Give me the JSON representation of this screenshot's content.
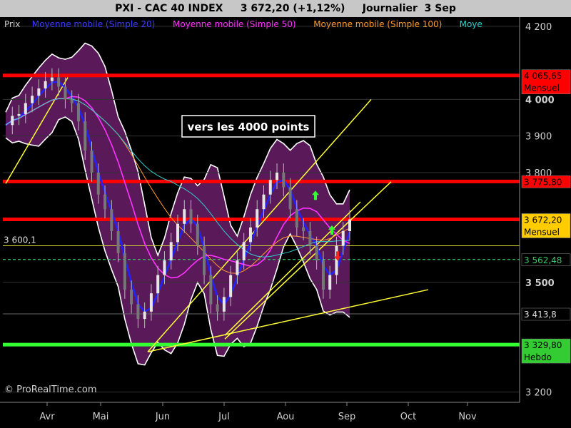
{
  "header": {
    "title": "PXI - CAC 40 INDEX     3 672,20 (+1,12%)     Journalier  3 Sep"
  },
  "chart_data": {
    "type": "candlestick",
    "legend": [
      {
        "label": "Prix",
        "color": "#cfcfcf"
      },
      {
        "label": "Moyenne mobile (Simple 20)",
        "color": "#3b3bff"
      },
      {
        "label": "Moyenne mobile (Simple 50)",
        "color": "#ff33ff"
      },
      {
        "label": "Moyenne mobile (Simple 100)",
        "color": "#ff9a2e"
      },
      {
        "label": "Moye",
        "color": "#33cccc"
      }
    ],
    "x_ticks": [
      "Avr",
      "Mai",
      "Jun",
      "Jul",
      "Aou",
      "Sep",
      "Oct",
      "Nov"
    ],
    "y_ticks": [
      {
        "value": 4200,
        "label": "4 200",
        "bold": false
      },
      {
        "value": 4000,
        "label": "4 000",
        "bold": true
      },
      {
        "value": 3900,
        "label": "3 900",
        "bold": false
      },
      {
        "value": 3800,
        "label": "3 800",
        "bold": false
      },
      {
        "value": 3500,
        "label": "3 500",
        "bold": true
      },
      {
        "value": 3200,
        "label": "3 200",
        "bold": false
      }
    ],
    "ylim": [
      3172,
      4225
    ],
    "close_series": [
      3930,
      3955,
      3960,
      3990,
      4010,
      4030,
      4050,
      4060,
      4035,
      4000,
      3990,
      3940,
      3860,
      3800,
      3740,
      3700,
      3640,
      3580,
      3480,
      3440,
      3400,
      3420,
      3470,
      3520,
      3560,
      3610,
      3660,
      3700,
      3660,
      3600,
      3520,
      3440,
      3420,
      3460,
      3520,
      3560,
      3610,
      3650,
      3700,
      3740,
      3780,
      3800,
      3760,
      3700,
      3650,
      3640,
      3600,
      3560,
      3480,
      3520,
      3600,
      3640,
      3672
    ],
    "annotation": "vers les 4000 points",
    "level_labels": [
      {
        "value": 4065.65,
        "label": "4 065,65",
        "sub": "Mensuel",
        "bg": "#ff0000",
        "fg": "#000000",
        "line": "#ff0000",
        "line_style": "thick"
      },
      {
        "value": 3775.8,
        "label": "3 775,80",
        "sub": "",
        "bg": "#ff0000",
        "fg": "#000000",
        "line": "#ff0000",
        "line_style": "thick"
      },
      {
        "value": 3672.2,
        "label": "3 672,20",
        "sub": "Mensuel",
        "bg": "#ffcc00",
        "fg": "#000000",
        "line": "#ff0000",
        "line_style": "thick"
      },
      {
        "value": 3562.48,
        "label": "3 562,48",
        "sub": "",
        "bg": "#000000",
        "fg": "#33cc66",
        "line": "#33cc66",
        "line_style": "dashed"
      },
      {
        "value": 3413.8,
        "label": "3 413,8",
        "sub": "",
        "bg": "#000000",
        "fg": "#dddddd",
        "line": "#666666",
        "line_style": "thin"
      },
      {
        "value": 3329.8,
        "label": "3 329,80",
        "sub": "Hebdo",
        "bg": "#33cc33",
        "fg": "#000000",
        "line": "#33ff33",
        "line_style": "thick"
      }
    ],
    "left_label": {
      "value": 3600.1,
      "label": "3 600,1"
    },
    "watermark": "© ProRealTime.com",
    "colors": {
      "band": "#5a1a5a",
      "ma20": "#2222ff",
      "ma50": "#ff33ff",
      "ma100": "#ff9a2e",
      "ma200": "#33cccc",
      "trend": "#ffff33"
    }
  }
}
